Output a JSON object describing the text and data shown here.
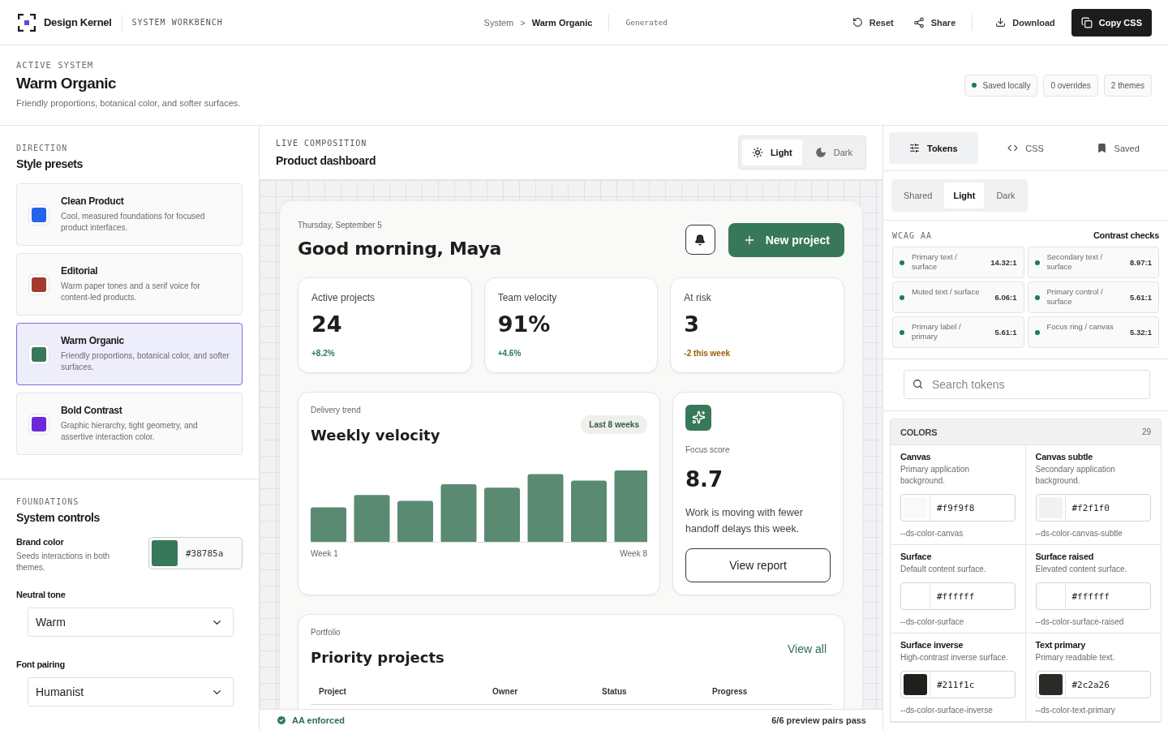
{
  "topbar": {
    "brand": "Design Kernel",
    "workbench": "SYSTEM WORKBENCH",
    "breadcrumb": [
      "System",
      "Warm Organic"
    ],
    "separator": ">",
    "status": "Generated",
    "actions": [
      {
        "kind": "reset",
        "label": "Reset"
      },
      {
        "kind": "share",
        "label": "Share"
      },
      {
        "kind": "download",
        "label": "Download"
      },
      {
        "kind": "copy",
        "label": "Copy CSS"
      }
    ]
  },
  "system": {
    "eyebrow": "ACTIVE SYSTEM",
    "title": "Warm Organic",
    "description": "Friendly proportions, botanical color, and softer surfaces.",
    "badges": [
      {
        "kind": "status",
        "label": "Saved locally",
        "color": "#1f7a55"
      },
      {
        "kind": "plain",
        "label": "0 overrides"
      },
      {
        "kind": "plain",
        "label": "2 themes"
      }
    ]
  },
  "direction": {
    "eyebrow": "DIRECTION",
    "title": "Style presets",
    "presets": [
      {
        "name": "Clean Product",
        "description": "Cool, measured foundations for focused product interfaces.",
        "color": "#2563eb",
        "selected": false
      },
      {
        "name": "Editorial",
        "description": "Warm paper tones and a serif voice for content-led products.",
        "color": "#a23b2c",
        "selected": false
      },
      {
        "name": "Warm Organic",
        "description": "Friendly proportions, botanical color, and softer surfaces.",
        "color": "#38785a",
        "selected": true
      },
      {
        "name": "Bold Contrast",
        "description": "Graphic hierarchy, tight geometry, and assertive interaction color.",
        "color": "#6d28d9",
        "selected": false
      }
    ]
  },
  "foundations": {
    "eyebrow": "FOUNDATIONS",
    "title": "System controls",
    "brand_color": {
      "label": "Brand color",
      "hint": "Seeds interactions in both themes.",
      "value": "#38785a"
    },
    "selects": [
      {
        "label": "Neutral tone",
        "value": "Warm"
      },
      {
        "label": "Font pairing",
        "value": "Humanist"
      }
    ]
  },
  "preview": {
    "eyebrow": "LIVE COMPOSITION",
    "title": "Product dashboard",
    "modes": [
      {
        "kind": "light",
        "label": "Light",
        "selected": true
      },
      {
        "kind": "dark",
        "label": "Dark",
        "selected": false
      }
    ],
    "dashboard": {
      "date": "Thursday, September 5",
      "greeting": "Good morning, Maya",
      "new_button": "New project",
      "stats": [
        {
          "label": "Active projects",
          "value": "24",
          "delta": "+8.2%",
          "color": "#2f7a55"
        },
        {
          "label": "Team velocity",
          "value": "91%",
          "delta": "+4.6%",
          "color": "#2f7a55"
        },
        {
          "label": "At risk",
          "value": "3",
          "delta": "-2 this week",
          "color": "#9a5b00"
        }
      ],
      "trend": {
        "eyebrow": "Delivery trend",
        "title": "Weekly velocity",
        "badge": "Last 8 weeks",
        "start_label": "Week 1",
        "end_label": "Week 8"
      },
      "focus": {
        "eyebrow": "Focus score",
        "value": "8.7",
        "text": "Work is moving with fewer handoff delays this week.",
        "button": "View report"
      },
      "projects": {
        "eyebrow": "Portfolio",
        "title": "Priority projects",
        "link": "View all",
        "columns": [
          "Project",
          "Owner",
          "Status",
          "Progress"
        ]
      }
    },
    "footer": {
      "status": "AA enforced",
      "summary": "6/6 preview pairs pass"
    }
  },
  "inspector": {
    "tabs": [
      {
        "kind": "tokens",
        "label": "Tokens",
        "selected": true
      },
      {
        "kind": "css",
        "label": "CSS",
        "selected": false
      },
      {
        "kind": "saved",
        "label": "Saved",
        "selected": false
      }
    ],
    "themes": [
      {
        "label": "Shared",
        "selected": false
      },
      {
        "label": "Light",
        "selected": true
      },
      {
        "label": "Dark",
        "selected": false
      }
    ],
    "contrast": {
      "eyebrow": "WCAG AA",
      "title": "Contrast checks",
      "checks": [
        {
          "label": "Primary text / surface",
          "ratio": "14.32:1",
          "color": "#1f7a55"
        },
        {
          "label": "Secondary text / surface",
          "ratio": "8.97:1",
          "color": "#1f7a55"
        },
        {
          "label": "Muted text / surface",
          "ratio": "6.06:1",
          "color": "#1f7a55"
        },
        {
          "label": "Primary control / surface",
          "ratio": "5.61:1",
          "color": "#1f7a55"
        },
        {
          "label": "Primary label / primary",
          "ratio": "5.61:1",
          "color": "#1f7a55"
        },
        {
          "label": "Focus ring / canvas",
          "ratio": "5.32:1",
          "color": "#1f7a55"
        }
      ]
    },
    "search": {
      "placeholder": "Search tokens"
    },
    "colors": {
      "title": "COLORS",
      "count": "29",
      "tokens": [
        {
          "name": "Canvas",
          "description": "Primary application background.",
          "value": "#f9f9f8",
          "variable": "--ds-color-canvas"
        },
        {
          "name": "Canvas subtle",
          "description": "Secondary application background.",
          "value": "#f2f1f0",
          "variable": "--ds-color-canvas-subtle"
        },
        {
          "name": "Surface",
          "description": "Default content surface.",
          "value": "#ffffff",
          "variable": "--ds-color-surface"
        },
        {
          "name": "Surface raised",
          "description": "Elevated content surface.",
          "value": "#ffffff",
          "variable": "--ds-color-surface-raised"
        },
        {
          "name": "Surface inverse",
          "description": "High-contrast inverse surface.",
          "value": "#211f1c",
          "variable": "--ds-color-surface-inverse"
        },
        {
          "name": "Text primary",
          "description": "Primary readable text.",
          "value": "#2c2a26",
          "variable": "--ds-color-text-primary"
        }
      ]
    }
  }
}
